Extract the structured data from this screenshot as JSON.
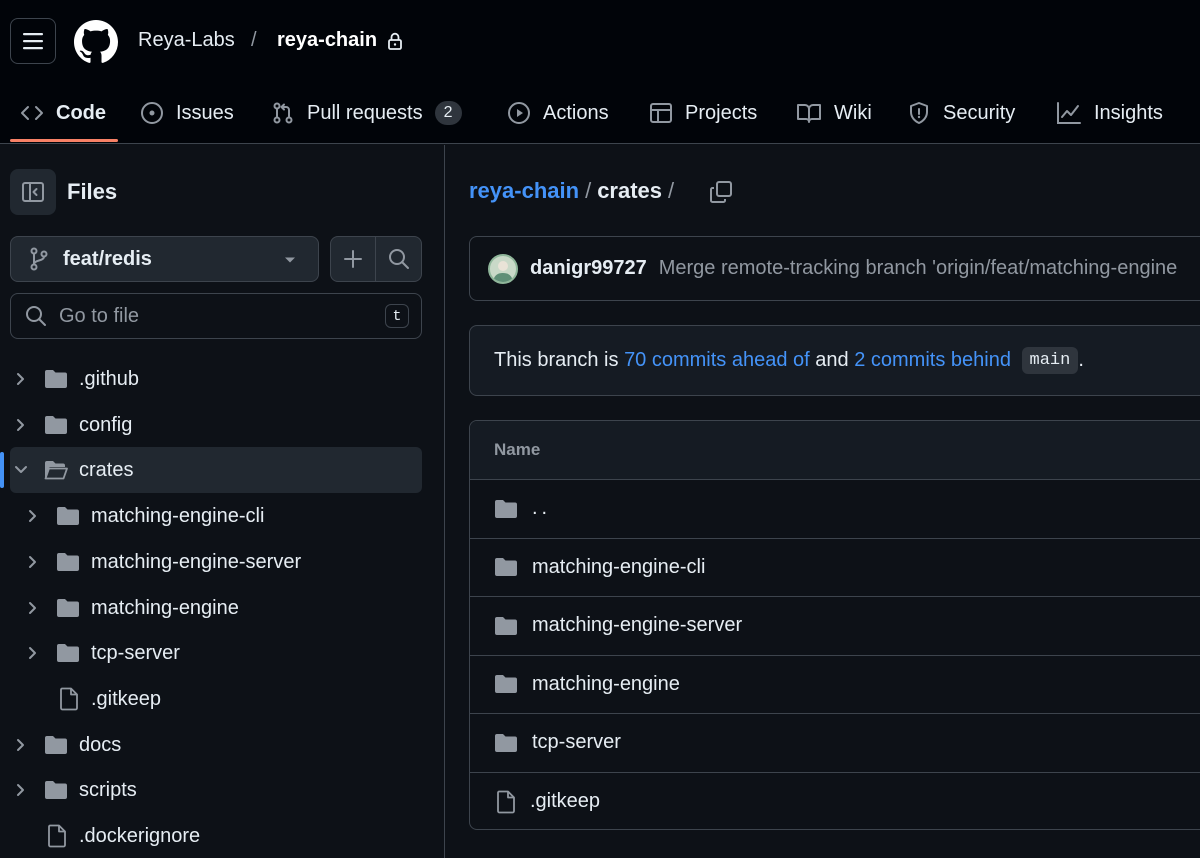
{
  "header": {
    "owner": "Reya-Labs",
    "separator": "/",
    "repo": "reya-chain"
  },
  "nav": {
    "tabs": [
      {
        "label": "Code",
        "icon": "code-icon"
      },
      {
        "label": "Issues",
        "icon": "issues-icon"
      },
      {
        "label": "Pull requests",
        "icon": "pull-request-icon",
        "count": "2"
      },
      {
        "label": "Actions",
        "icon": "play-icon"
      },
      {
        "label": "Projects",
        "icon": "table-icon"
      },
      {
        "label": "Wiki",
        "icon": "book-icon"
      },
      {
        "label": "Security",
        "icon": "shield-icon"
      },
      {
        "label": "Insights",
        "icon": "graph-icon"
      }
    ]
  },
  "sidebar": {
    "title": "Files",
    "branch": "feat/redis",
    "search_placeholder": "Go to file",
    "search_shortcut": "t",
    "tree": [
      {
        "label": ".github",
        "type": "folder"
      },
      {
        "label": "config",
        "type": "folder"
      },
      {
        "label": "crates",
        "type": "folder-open"
      },
      {
        "label": "matching-engine-cli",
        "type": "folder"
      },
      {
        "label": "matching-engine-server",
        "type": "folder"
      },
      {
        "label": "matching-engine",
        "type": "folder"
      },
      {
        "label": "tcp-server",
        "type": "folder"
      },
      {
        "label": ".gitkeep",
        "type": "file"
      },
      {
        "label": "docs",
        "type": "folder"
      },
      {
        "label": "scripts",
        "type": "folder"
      },
      {
        "label": ".dockerignore",
        "type": "file"
      }
    ]
  },
  "main": {
    "breadcrumb": {
      "repo": "reya-chain",
      "sep1": "/",
      "current": "crates",
      "sep2": "/"
    },
    "commit": {
      "author": "danigr99727",
      "message": "Merge remote-tracking branch 'origin/feat/matching-engine"
    },
    "branch_status": {
      "prefix": "This branch is",
      "ahead": "70 commits ahead of",
      "middle": "and",
      "behind": "2 commits behind",
      "base": "main",
      "suffix": "."
    },
    "table": {
      "header": "Name",
      "rows": [
        {
          "name": "..",
          "type": "folder"
        },
        {
          "name": "matching-engine-cli",
          "type": "folder"
        },
        {
          "name": "matching-engine-server",
          "type": "folder"
        },
        {
          "name": "matching-engine",
          "type": "folder"
        },
        {
          "name": "tcp-server",
          "type": "folder"
        },
        {
          "name": ".gitkeep",
          "type": "file"
        }
      ]
    }
  },
  "colors": {
    "background": "#0d1117",
    "header_bg": "#010409",
    "accent_link": "#4493f8",
    "tab_underline": "#f78166",
    "border": "#3d444d"
  }
}
